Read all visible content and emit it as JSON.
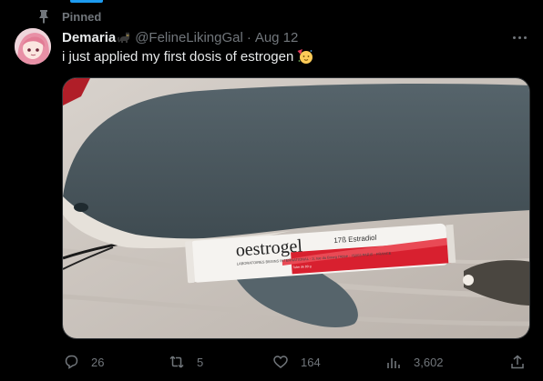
{
  "pinned": {
    "label": "Pinned",
    "icon": "pin-icon"
  },
  "tweet": {
    "author": {
      "name": "Demaria",
      "badge_icon": "black-cat-emoji",
      "handle": "@FelineLikingGal",
      "separator": "·",
      "date": "Aug 12"
    },
    "text": "i just applied my first dosis of estrogen",
    "emoji": "partying-face-emoji",
    "media": {
      "tube_brand": "oestrogel",
      "tube_subtitle": "17ß Estradiol",
      "tube_line1": "LABORATOIRES BESINS INTERNATIONAL - 3, rue du Bourg l'Abbé - 75003 PARIS - FRANCE",
      "tube_line2": "GEL POUR APPLICATION CUTANÉE, Tube de 80 g"
    },
    "actions": {
      "replies": "26",
      "reposts": "5",
      "likes": "164",
      "views": "3,602"
    }
  },
  "colors": {
    "accent": "#1d9bf0",
    "muted": "#71767b",
    "text": "#e7e9ea",
    "border": "#2f3336",
    "tube_red": "#d8202f"
  }
}
